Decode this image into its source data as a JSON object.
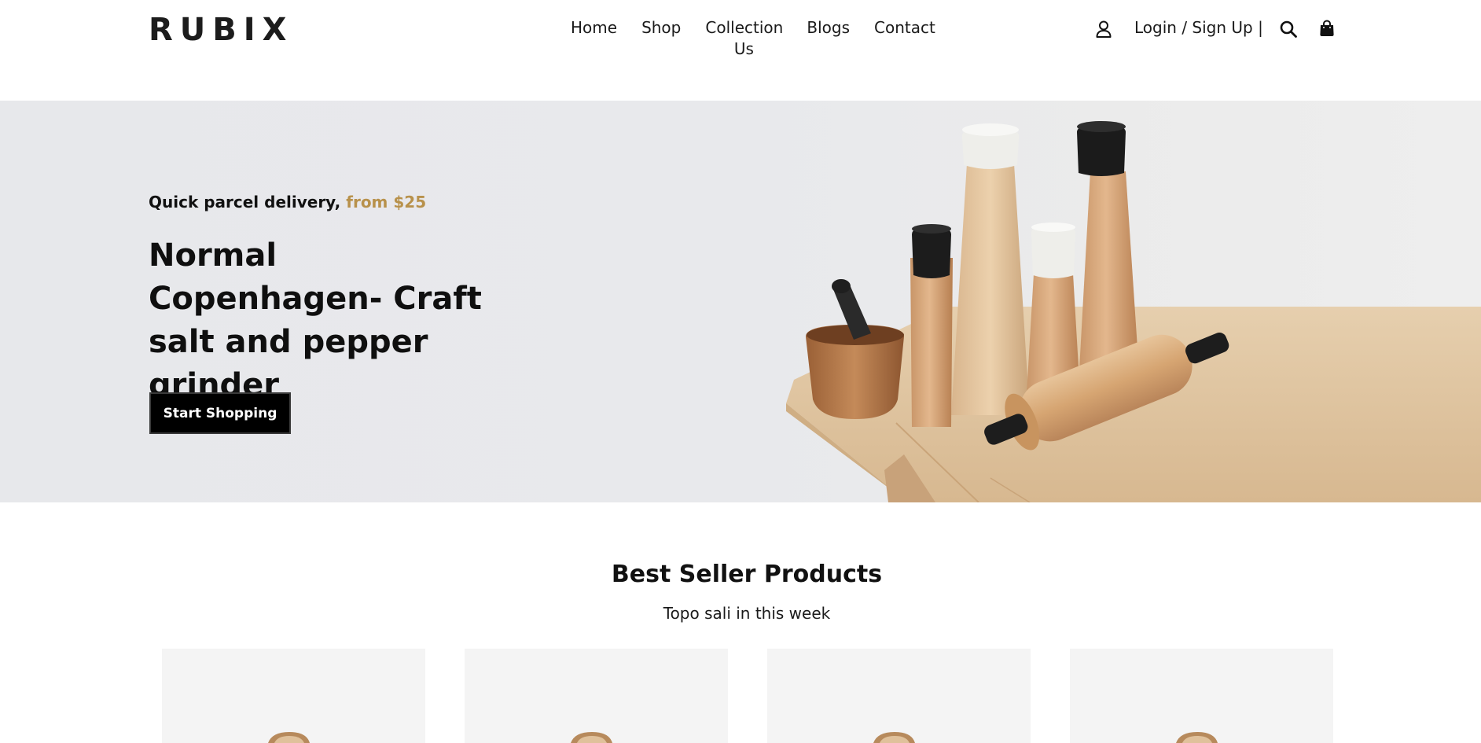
{
  "brand": {
    "logo_text": "RUBIX"
  },
  "nav": {
    "items": [
      {
        "label": "Home"
      },
      {
        "label": "Shop"
      },
      {
        "label": "Collection Us"
      },
      {
        "label": "Blogs"
      },
      {
        "label": "Contact"
      }
    ]
  },
  "header_actions": {
    "user_icon": "user-icon",
    "login_label": "Login / Sign Up |",
    "search_icon": "search-icon",
    "cart_icon": "shopping-bag-icon"
  },
  "hero": {
    "kicker_text": "Quick parcel delivery,",
    "kicker_accent": "from $25",
    "title": "Normal Copenhagen- Craft salt and pepper grinder",
    "button_label": "Start Shopping",
    "accent_color": "#b8914b"
  },
  "best_sellers": {
    "title": "Best Seller Products",
    "subtitle": "Topo sali in this week"
  }
}
